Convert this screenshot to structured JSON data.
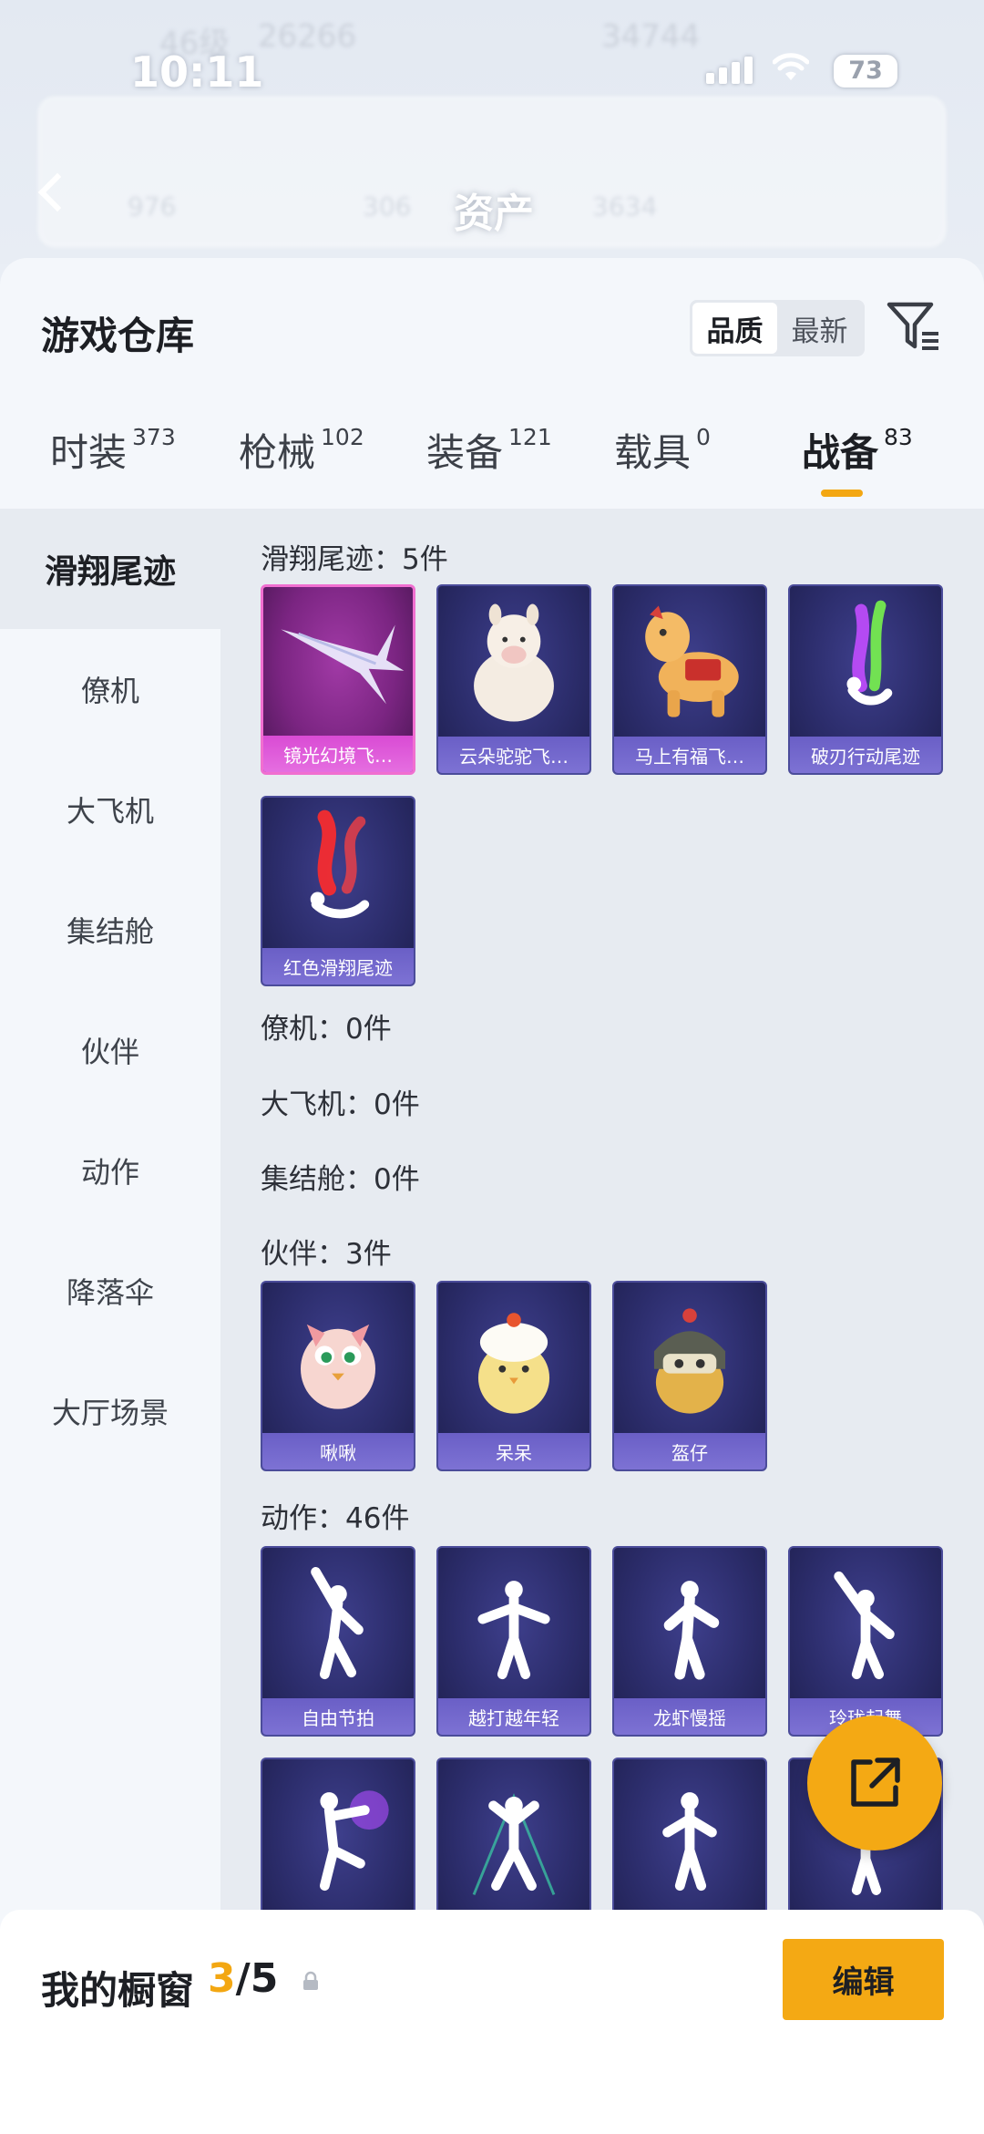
{
  "status_bar": {
    "time": "10:11",
    "battery": "73"
  },
  "background": {
    "level": "46级",
    "coins": "26266",
    "coins2": "34744",
    "title": "资产",
    "stats": [
      "976",
      "306",
      "3634"
    ]
  },
  "header": {
    "title": "游戏仓库",
    "sort_options": [
      "品质",
      "最新"
    ],
    "active_sort": "品质"
  },
  "tabs": [
    {
      "label": "时装",
      "count": "373"
    },
    {
      "label": "枪械",
      "count": "102"
    },
    {
      "label": "装备",
      "count": "121"
    },
    {
      "label": "载具",
      "count": "0"
    },
    {
      "label": "战备",
      "count": "83"
    }
  ],
  "active_tab": "战备",
  "sidebar": {
    "items": [
      "滑翔尾迹",
      "僚机",
      "大飞机",
      "集结舱",
      "伙伴",
      "动作",
      "降落伞",
      "大厅场景"
    ],
    "active": "滑翔尾迹"
  },
  "sections": {
    "glide": {
      "header": "滑翔尾迹：5件",
      "items": [
        "镜光幻境飞…",
        "云朵驼驼飞…",
        "马上有福飞…",
        "破刃行动尾迹",
        "红色滑翔尾迹"
      ]
    },
    "wingman": {
      "header": "僚机：0件"
    },
    "plane": {
      "header": "大飞机：0件"
    },
    "pod": {
      "header": "集结舱：0件"
    },
    "partner": {
      "header": "伙伴：3件",
      "items": [
        "啾啾",
        "呆呆",
        "盔仔"
      ]
    },
    "emote": {
      "header": "动作：46件",
      "items": [
        "自由节拍",
        "越打越年轻",
        "龙虾慢摇",
        "玲珑起舞"
      ]
    }
  },
  "bottom_bar": {
    "label": "我的橱窗",
    "current": "3",
    "total": "/5",
    "edit_label": "编辑"
  },
  "colors": {
    "accent": "#f4a914",
    "card_bg": "#2c2d6c",
    "card_label": "#7368cd",
    "pink_card": "#7b2582"
  }
}
